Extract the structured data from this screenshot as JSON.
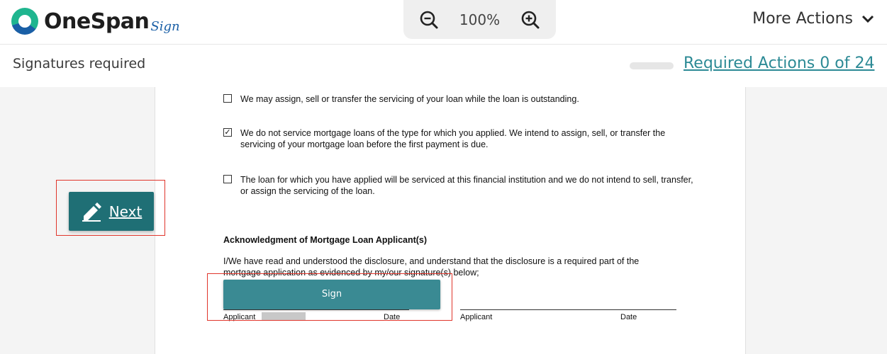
{
  "header": {
    "logo_text": "OneSpan",
    "logo_sub": "Sign",
    "zoom_level": "100%",
    "more_actions_label": "More Actions"
  },
  "subheader": {
    "title": "Signatures required",
    "required_actions_label": "Required Actions 0 of 24",
    "progress": 0
  },
  "document": {
    "options": [
      {
        "checked": false,
        "text": "We may assign, sell or transfer the servicing of your loan while the loan is outstanding."
      },
      {
        "checked": true,
        "text": "We do not service mortgage loans of the type for which you applied. We intend to assign, sell, or transfer the servicing of your mortgage loan before the first payment is due."
      },
      {
        "checked": false,
        "text": "The loan for which you have applied will be serviced at this financial institution and we do not intend to sell, transfer, or assign the servicing of the loan."
      }
    ],
    "section_heading": "Acknowledgment of Mortgage Loan Applicant(s)",
    "ack_text": "I/We have read and understood the disclosure, and understand that the disclosure is a required part of the mortgage application as evidenced by my/our signature(s) below;",
    "sign_button_label": "Sign",
    "labels": {
      "applicant1": "Applicant",
      "date1": "Date",
      "applicant2": "Applicant",
      "date2": "Date"
    }
  },
  "navigation": {
    "next_button_label": "Next"
  },
  "colors": {
    "teal": "#3a8a93",
    "dark_teal": "#1f6f75",
    "link": "#2c8a95",
    "highlight": "#e0352b"
  }
}
